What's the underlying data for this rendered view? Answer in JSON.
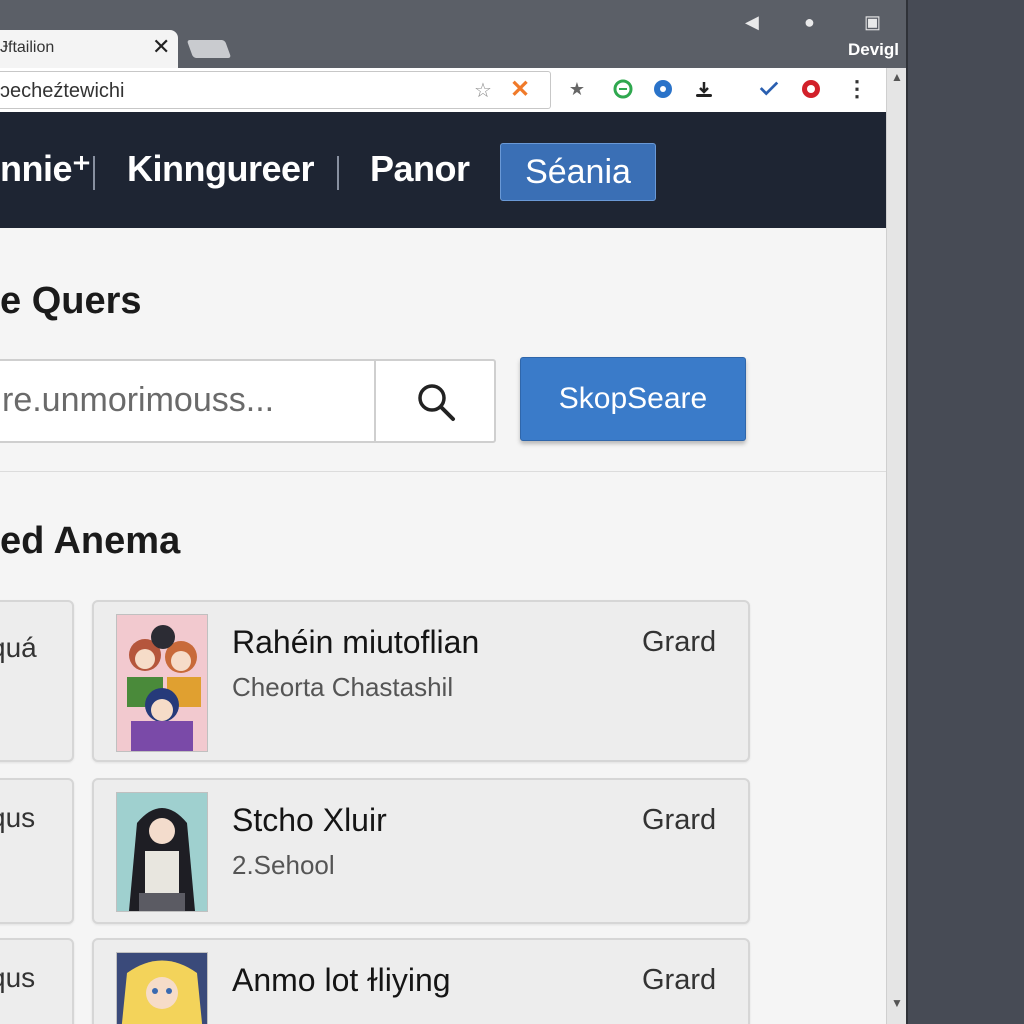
{
  "browser": {
    "tab_title": "Ɉftailion",
    "tab_close": "✕",
    "device_label": "Devigl",
    "url": "ɔecheźtewichi",
    "url_star": "☆",
    "url_stop": "✕",
    "bookmark_star": "★",
    "menu": "⋮"
  },
  "nav": {
    "items": [
      "nnie⁺",
      "Kinngureer",
      "Panor"
    ],
    "active": "Séania"
  },
  "search": {
    "heading": "e Quers",
    "placeholder": "re.unmorimouss...",
    "button_label": "SkopSeare"
  },
  "results": {
    "heading": "ed Anema",
    "left_items": [
      "quá",
      "qus",
      "qus"
    ],
    "cards": [
      {
        "title": "Rahéin miutoflian",
        "subtitle": "Cheorta Chastashil",
        "tag": "Grard"
      },
      {
        "title": "Stcho Xluir",
        "subtitle": "2.Sehool",
        "tag": "Grard"
      },
      {
        "title": "Anmo lot ɫliying",
        "subtitle": "",
        "tag": "Grard"
      }
    ]
  }
}
